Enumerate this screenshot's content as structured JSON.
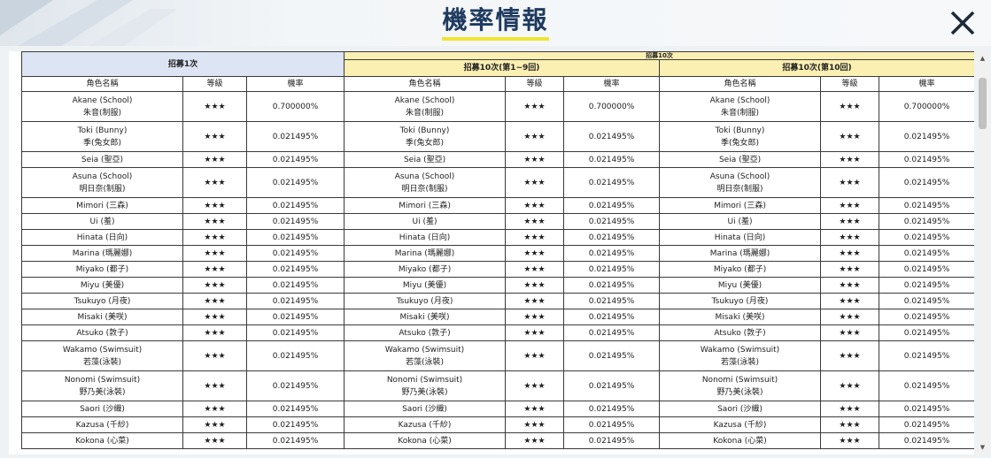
{
  "page": {
    "title": "機率情報",
    "close_label": "×"
  },
  "table": {
    "group_single": "招募1次",
    "group_ten": "招募10次",
    "sub_ten_1_9": "招募10次(第1~9回)",
    "sub_ten_10": "招募10次(第10回)",
    "col_name": "角色名稱",
    "col_grade": "等級",
    "col_rate": "機率",
    "rows": [
      {
        "name": "Akane (School)",
        "sub": "朱音(制服)",
        "stars": "★★★",
        "rate1": "0.700000%",
        "rate2": "0.700000%",
        "rate3": "0.700000%"
      },
      {
        "name": "Toki (Bunny)",
        "sub": "季(兔女郎)",
        "stars": "★★★",
        "rate1": "0.021495%",
        "rate2": "0.021495%",
        "rate3": "0.021495%"
      },
      {
        "name": "Seia (聖亞)",
        "sub": "",
        "stars": "★★★",
        "rate1": "0.021495%",
        "rate2": "0.021495%",
        "rate3": "0.021495%"
      },
      {
        "name": "Asuna (School)",
        "sub": "明日奈(制服)",
        "stars": "★★★",
        "rate1": "0.021495%",
        "rate2": "0.021495%",
        "rate3": "0.021495%"
      },
      {
        "name": "Mimori (三森)",
        "sub": "",
        "stars": "★★★",
        "rate1": "0.021495%",
        "rate2": "0.021495%",
        "rate3": "0.021495%"
      },
      {
        "name": "Ui (羞)",
        "sub": "",
        "stars": "★★★",
        "rate1": "0.021495%",
        "rate2": "0.021495%",
        "rate3": "0.021495%"
      },
      {
        "name": "Hinata (日向)",
        "sub": "",
        "stars": "★★★",
        "rate1": "0.021495%",
        "rate2": "0.021495%",
        "rate3": "0.021495%"
      },
      {
        "name": "Marina (瑪麗娜)",
        "sub": "",
        "stars": "★★★",
        "rate1": "0.021495%",
        "rate2": "0.021495%",
        "rate3": "0.021495%"
      },
      {
        "name": "Miyako (都子)",
        "sub": "",
        "stars": "★★★",
        "rate1": "0.021495%",
        "rate2": "0.021495%",
        "rate3": "0.021495%"
      },
      {
        "name": "Miyu (美優)",
        "sub": "",
        "stars": "★★★",
        "rate1": "0.021495%",
        "rate2": "0.021495%",
        "rate3": "0.021495%"
      },
      {
        "name": "Tsukuyo (月夜)",
        "sub": "",
        "stars": "★★★",
        "rate1": "0.021495%",
        "rate2": "0.021495%",
        "rate3": "0.021495%"
      },
      {
        "name": "Misaki (美咲)",
        "sub": "",
        "stars": "★★★",
        "rate1": "0.021495%",
        "rate2": "0.021495%",
        "rate3": "0.021495%"
      },
      {
        "name": "Atsuko (敦子)",
        "sub": "",
        "stars": "★★★",
        "rate1": "0.021495%",
        "rate2": "0.021495%",
        "rate3": "0.021495%"
      },
      {
        "name": "Wakamo (Swimsuit)",
        "sub": "若藻(泳裝)",
        "stars": "★★★",
        "rate1": "0.021495%",
        "rate2": "0.021495%",
        "rate3": "0.021495%"
      },
      {
        "name": "Nonomi (Swimsuit)",
        "sub": "野乃美(泳裝)",
        "stars": "★★★",
        "rate1": "0.021495%",
        "rate2": "0.021495%",
        "rate3": "0.021495%"
      },
      {
        "name": "Saori (沙織)",
        "sub": "",
        "stars": "★★★",
        "rate1": "0.021495%",
        "rate2": "0.021495%",
        "rate3": "0.021495%"
      },
      {
        "name": "Kazusa (千紗)",
        "sub": "",
        "stars": "★★★",
        "rate1": "0.021495%",
        "rate2": "0.021495%",
        "rate3": "0.021495%"
      },
      {
        "name": "Kokona (心菜)",
        "sub": "",
        "stars": "★★★",
        "rate1": "0.021495%",
        "rate2": "0.021495%",
        "rate3": "0.021495%"
      }
    ]
  },
  "colors": {
    "title": "#1e3a5f",
    "title_underline": "#f2e430",
    "single_header_bg": "#dde4f3",
    "ten_header_bg": "#fbefb2"
  },
  "icons": {
    "close": "close-icon",
    "scroll_up": "scroll-up-arrow-icon",
    "scroll_down": "scroll-down-arrow-icon"
  }
}
